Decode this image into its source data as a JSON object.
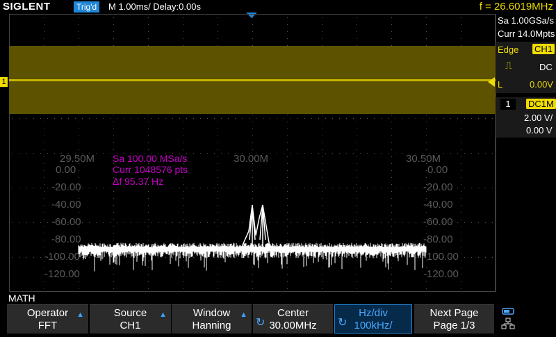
{
  "topbar": {
    "brand": "SIGLENT",
    "trig_status": "Trig'd",
    "timebase": "M 1.00ms/ Delay:0.00s",
    "frequency": "f = 26.6019MHz"
  },
  "acquisition": {
    "sample_rate": "Sa 1.00GSa/s",
    "memory": "Curr 14.0Mpts"
  },
  "trigger": {
    "type_label": "Edge",
    "source": "CH1",
    "coupling": "DC",
    "level_label": "L",
    "level": "0.00V"
  },
  "channel": {
    "number": "1",
    "name": "DC1M",
    "scale": "2.00 V/",
    "offset": "0.00 V"
  },
  "fft": {
    "freq_labels": [
      "29.50M",
      "30.00M",
      "30.50M"
    ],
    "db_labels": [
      "0.00",
      "-20.00",
      "-40.00",
      "-60.00",
      "-80.00",
      "-100.00",
      "-120.00"
    ],
    "info_sa": "Sa 100.00 MSa/s",
    "info_curr": "Curr 1048576 pts",
    "info_df": "Δf 95.37 Hz"
  },
  "chart_data": {
    "type": "line",
    "title": "",
    "xlabel": "",
    "ylabel": "",
    "x_range_hz": [
      29500000,
      30500000
    ],
    "ylim": [
      -130,
      0
    ],
    "series": [
      {
        "x_mhz": [
          29.5,
          29.8,
          29.95,
          29.97,
          29.99,
          30.0,
          30.01,
          30.02,
          30.03,
          30.05,
          30.2,
          30.5
        ],
        "values": [
          -90,
          -90,
          -90,
          -88,
          -70,
          -40,
          -75,
          -55,
          -40,
          -88,
          -90,
          -90
        ]
      }
    ],
    "noise_floor_db": -90,
    "peaks": [
      {
        "x_mhz": 30.0,
        "db": -40
      },
      {
        "x_mhz": 30.03,
        "db": -40
      }
    ],
    "colors": {
      "trace": "#ffffff",
      "ch1": "#f0dc00",
      "math_text": "#c800c8"
    }
  },
  "math_label": "MATH",
  "softkeys": [
    {
      "line1": "Operator",
      "line2": "FFT"
    },
    {
      "line1": "Source",
      "line2": "CH1"
    },
    {
      "line1": "Window",
      "line2": "Hanning"
    },
    {
      "line1": "Center",
      "line2": "30.00MHz"
    },
    {
      "line1": "Hz/div",
      "line2": "100kHz/"
    },
    {
      "line1": "Next Page",
      "line2": "Page 1/3"
    }
  ]
}
